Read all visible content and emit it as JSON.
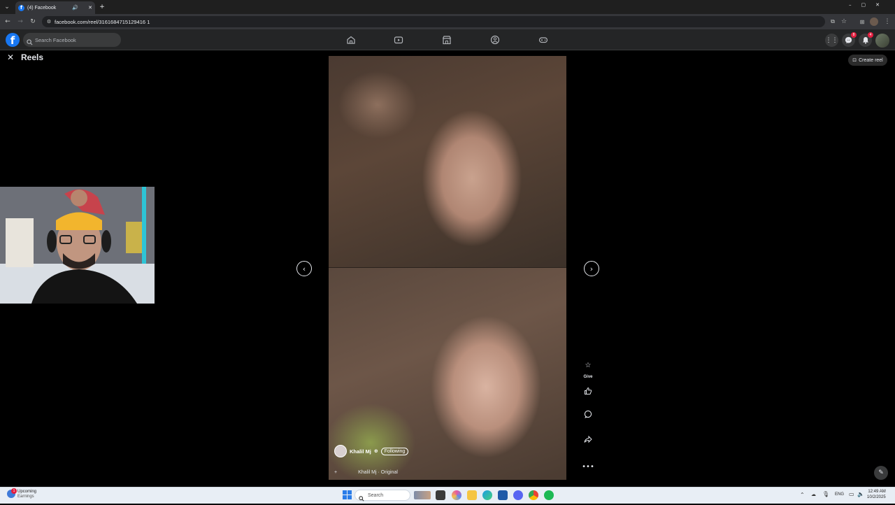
{
  "browser": {
    "tab_title": "(4) Facebook",
    "url": "facebook.com/reel/3161684715129416 1",
    "new_tab_symbol": "+",
    "window_controls": [
      "–",
      "▢",
      "✕"
    ]
  },
  "fb_nav": {
    "logo": "f",
    "search_placeholder": "Search Facebook",
    "messenger_badge": "8",
    "notifications_badge": "4"
  },
  "page": {
    "title": "Reels",
    "create_reel_label": "Create reel"
  },
  "reel": {
    "author_name": "Khalil Mj",
    "follow_label": "Following",
    "audio_left": "+",
    "audio_text": "Khalil Mj · Original"
  },
  "side_actions": {
    "give_label": "Give"
  },
  "taskbar": {
    "weather_title": "Upcoming",
    "weather_sub": "Earnings",
    "weather_badge": "1",
    "search_label": "Search",
    "lang": "ENG",
    "time": "12:49 AM",
    "date": "10/2/2025"
  },
  "colors": {
    "fb_blue": "#1877f2",
    "nav_bg": "#242526",
    "badge_red": "#e41e3f"
  }
}
